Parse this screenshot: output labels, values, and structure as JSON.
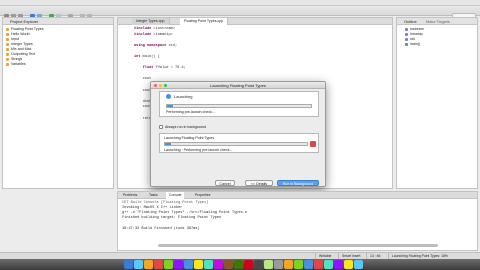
{
  "left_panel": {
    "title": "Project Explorer",
    "items": [
      {
        "label": "Floating Point Types",
        "color": "#e8a33d"
      },
      {
        "label": "Hello World",
        "color": "#e8a33d"
      },
      {
        "label": "Input",
        "color": "#e8a33d"
      },
      {
        "label": "Integer Types",
        "color": "#e8a33d"
      },
      {
        "label": "Mix and Max",
        "color": "#e8a33d"
      },
      {
        "label": "Outputting Text",
        "color": "#e8a33d"
      },
      {
        "label": "Strings",
        "color": "#e8a33d"
      },
      {
        "label": "Variables",
        "color": "#e8a33d"
      }
    ]
  },
  "editor": {
    "tabs": [
      "Integer Types.cpp",
      "Floating Point Types.cpp"
    ],
    "code": [
      "#include <iostream>",
      "#include <iomanip>",
      "",
      "using namespace std;",
      "",
      "int main() {",
      "",
      "    float fValue = 76.4;",
      "",
      "    cout",
      "",
      "    cout",
      "",
      "    doub",
      "    cout",
      "",
      "    retu"
    ]
  },
  "right_panel": {
    "title": "Outline",
    "title2": "Make Targets",
    "items": [
      "iostream",
      "iomanip",
      "std",
      "main()"
    ]
  },
  "dialog": {
    "title": "Launching Floating Point Types",
    "section_title": "Launching",
    "progress_label": "Performing pre-launch check...",
    "progress": 0.04,
    "checkbox_label": "Always run in background",
    "task_title": "Launching Floating Point Types",
    "task_label": "Launching : Performing pre-launch check...",
    "task_progress": 0.04,
    "buttons": {
      "cancel": "Cancel",
      "details": "<< Details",
      "background": "Run in Background"
    }
  },
  "console": {
    "tabs": [
      "Problems",
      "Tasks",
      "Console",
      "Properties"
    ],
    "header": "CDT Build Console [Floating Point Types]",
    "lines": [
      "Invoking: MacOS X C++ Linker",
      "g++  -o \"Floating Point Types\"  ./src/Floating Point Types.o",
      "Finished building target: Floating Point Types",
      "",
      "18:47:32 Build Finished (took 367ms)"
    ]
  },
  "statusbar": {
    "mode": "Writable",
    "insert": "Smart Insert",
    "position": "13 : 46",
    "launch": "Launching Floating Point Types: 18%"
  },
  "colors": {
    "accent": "#4a90e2",
    "close": "#ff5f56",
    "min": "#ffbd2e",
    "max": "#27c93f"
  }
}
